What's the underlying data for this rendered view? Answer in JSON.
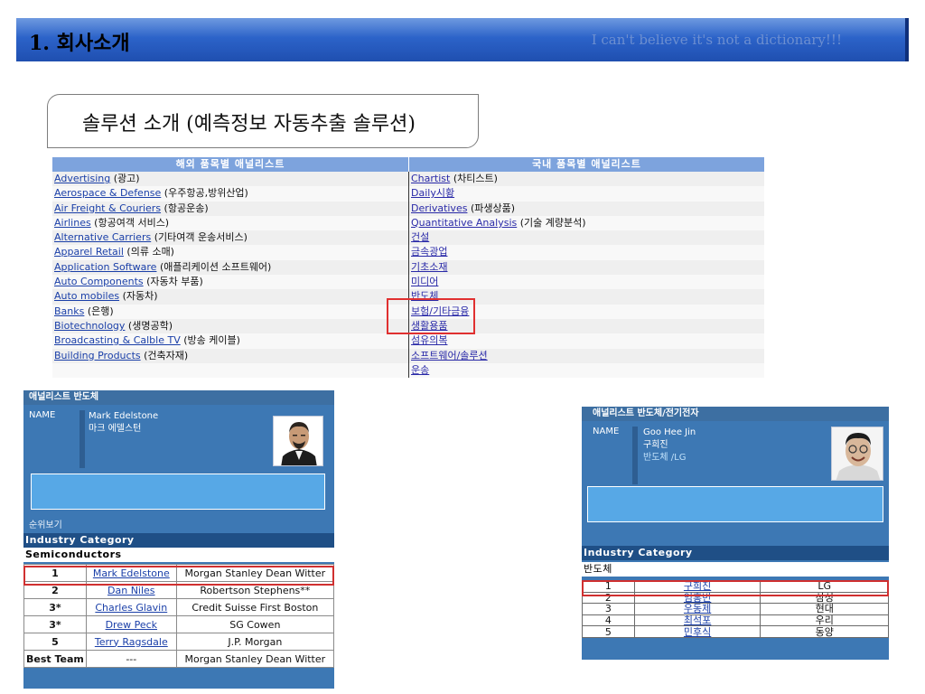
{
  "header": {
    "title": "1. 회사소개",
    "tagline": "I can't believe it's not a dictionary!!!"
  },
  "solution_title": "솔루션 소개 (예측정보 자동추출 솔루션)",
  "category_table": {
    "left_header": "해외 품목별 애널리스트",
    "right_header": "국내 품목별 애널리스트",
    "left_items": [
      {
        "link": "Advertising",
        "note": " (광고)"
      },
      {
        "link": "Aerospace & Defense",
        "note": " (우주항공,방위산업)"
      },
      {
        "link": "Air Freight & Couriers",
        "note": " (항공운송)"
      },
      {
        "link": "Airlines",
        "note": " (항공여객 서비스)"
      },
      {
        "link": "Alternative Carriers",
        "note": " (기타여객 운송서비스)"
      },
      {
        "link": "Apparel Retail",
        "note": " (의류 소매)"
      },
      {
        "link": "Application Software",
        "note": " (애플리케이션 소프트웨어)"
      },
      {
        "link": "Auto Components",
        "note": " (자동차 부품)"
      },
      {
        "link": "Auto mobiles",
        "note": " (자동차)"
      },
      {
        "link": "Banks",
        "note": " (은행)"
      },
      {
        "link": "Biotechnology",
        "note": " (생명공학)"
      },
      {
        "link": "Broadcasting & Calble TV",
        "note": " (방송 케이블)"
      },
      {
        "link": "Building Products",
        "note": " (건축자재)"
      }
    ],
    "right_items": [
      {
        "link": "Chartist",
        "note": " (차티스트)"
      },
      {
        "link": "Daily시황",
        "note": ""
      },
      {
        "link": "Derivatives",
        "note": " (파생상품)"
      },
      {
        "link": "Quantitative Analysis",
        "note": " (기술 계량분석)"
      },
      {
        "link": "건설",
        "note": ""
      },
      {
        "link": "금속광업",
        "note": ""
      },
      {
        "link": "기초소재",
        "note": ""
      },
      {
        "link": "미디어",
        "note": ""
      },
      {
        "link": "반도체",
        "note": ""
      },
      {
        "link": "보험/기타금융",
        "note": ""
      },
      {
        "link": "생활용품",
        "note": ""
      },
      {
        "link": "섬유의복",
        "note": ""
      },
      {
        "link": "소프트웨어/솔루션",
        "note": ""
      },
      {
        "link": "운송",
        "note": ""
      }
    ]
  },
  "card_left": {
    "bar_title": "애널리스트  반도체",
    "name_label": "NAME",
    "name_en": "Mark Edelstone",
    "name_ko": "마크 에델스턴",
    "link_text": "순위보기",
    "industry_header": "Industry Category",
    "industry_sub": "Semiconductors",
    "ranks": [
      {
        "rank": "1",
        "name": "Mark Edelstone",
        "firm": "Morgan Stanley Dean Witter"
      },
      {
        "rank": "2",
        "name": "Dan Niles",
        "firm": "Robertson Stephens**"
      },
      {
        "rank": "3*",
        "name": "Charles Glavin",
        "firm": "Credit Suisse First Boston"
      },
      {
        "rank": "3*",
        "name": "Drew Peck",
        "firm": "SG Cowen"
      },
      {
        "rank": "5",
        "name": "Terry Ragsdale",
        "firm": "J.P. Morgan"
      },
      {
        "rank": "Best Team",
        "name": "---",
        "firm": "Morgan Stanley Dean Witter"
      }
    ]
  },
  "card_right": {
    "bar_title": "애널리스트   반도체/전기전자",
    "name_label": "NAME",
    "name_en": "Goo Hee Jin",
    "name_ko": "구희진",
    "sector": "반도체 /LG",
    "industry_header": "Industry Category",
    "industry_sub": "반도체",
    "ranks": [
      {
        "rank": "1",
        "name": "구희진",
        "firm": "LG"
      },
      {
        "rank": "2",
        "name": "임홍빈",
        "firm": "삼성"
      },
      {
        "rank": "3",
        "name": "우동제",
        "firm": "현대"
      },
      {
        "rank": "4",
        "name": "최석포",
        "firm": "우리"
      },
      {
        "rank": "5",
        "name": "민후식",
        "firm": "동양"
      }
    ]
  },
  "colors": {
    "header_blue": "#2c63c9",
    "card_blue": "#3d78b4",
    "highlight_red": "#e03030",
    "link_blue": "#1a3fa8"
  }
}
